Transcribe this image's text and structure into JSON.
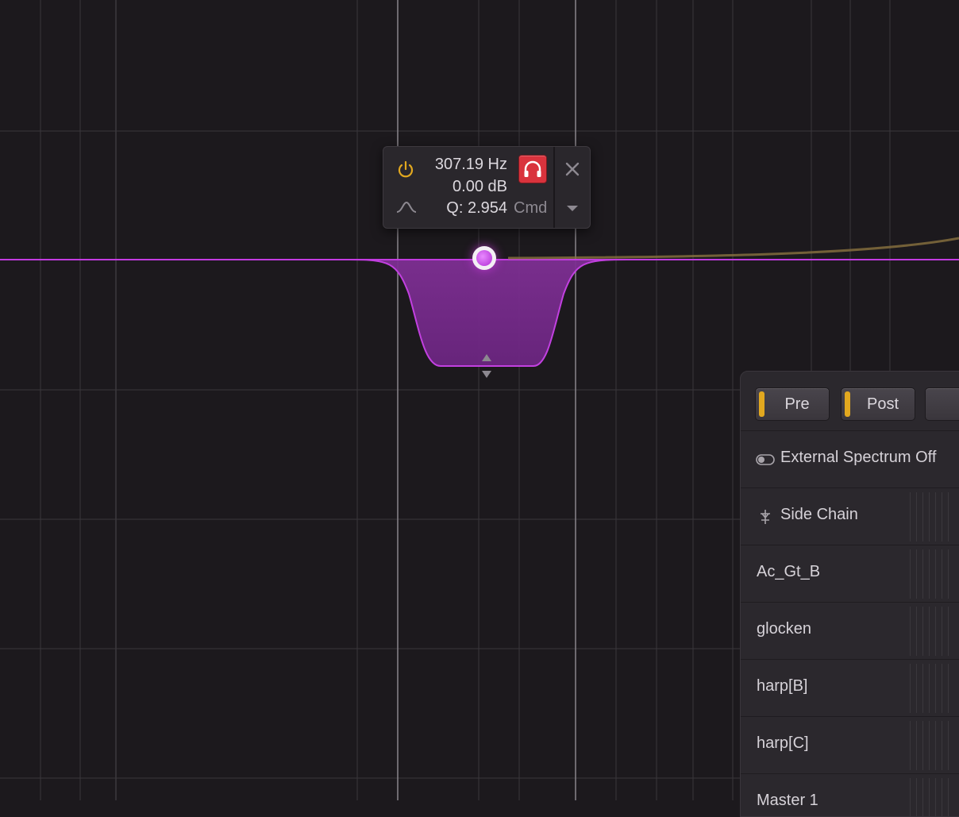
{
  "band": {
    "frequency": "307.19 Hz",
    "gain": "0.00 dB",
    "q": "Q: 2.954",
    "modifier_hint": "Cmd",
    "color": "#c23be0",
    "solo_color": "#d9333d",
    "power_color": "#e2a81f"
  },
  "spectrum_panel": {
    "tabs": [
      {
        "label": "Pre",
        "active": true
      },
      {
        "label": "Post",
        "active": true
      },
      {
        "label": ""
      }
    ],
    "external_spectrum": "External Spectrum Off",
    "side_chain": "Side Chain",
    "tracks": [
      "Ac_Gt_B",
      "glocken",
      "harp[B]",
      "harp[C]",
      "Master 1"
    ]
  },
  "icons": [
    "power-icon",
    "bell-shape-icon",
    "headphones-icon",
    "close-icon",
    "chevron-down-icon",
    "toggle-icon",
    "side-chain-icon",
    "up-arrow-icon",
    "down-arrow-icon"
  ]
}
